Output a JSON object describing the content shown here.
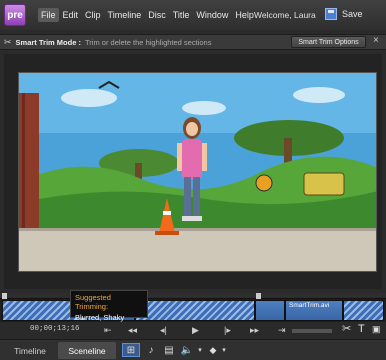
{
  "app": {
    "logo_text": "pre"
  },
  "menu": {
    "items": [
      "File",
      "Edit",
      "Clip",
      "Timeline",
      "Disc",
      "Title",
      "Window",
      "Help"
    ],
    "active": "File"
  },
  "header": {
    "welcome": "Welcome, Laura",
    "save_label": "Save"
  },
  "smart_trim": {
    "title": "Smart Trim Mode :",
    "description": "Trim or delete the highlighted sections",
    "options_button": "Smart Trim Options",
    "close_glyph": "×"
  },
  "tooltip": {
    "title": "Suggested Trimming:",
    "value": "Blurred, Shaky"
  },
  "timeline": {
    "timecode": "00;00;13;16",
    "clip_name": "SmartTrim.avi"
  },
  "bottom": {
    "tabs": [
      "Timeline",
      "Sceneline"
    ],
    "active_tab": "Sceneline"
  },
  "colors": {
    "accent": "#4b7fd1",
    "tooltip_title": "#f0a43a",
    "hatch_light": "#9dbbe6",
    "hatch_dark": "#3c6fb8"
  }
}
